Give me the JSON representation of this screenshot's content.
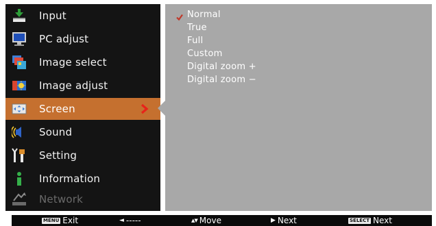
{
  "menu": {
    "items": [
      {
        "label": "Input",
        "icon": "input-icon"
      },
      {
        "label": "PC adjust",
        "icon": "monitor-icon"
      },
      {
        "label": "Image select",
        "icon": "image-select-icon"
      },
      {
        "label": "Image adjust",
        "icon": "image-adjust-icon"
      },
      {
        "label": "Screen",
        "icon": "screen-icon"
      },
      {
        "label": "Sound",
        "icon": "speaker-icon"
      },
      {
        "label": "Setting",
        "icon": "wrench-icon"
      },
      {
        "label": "Information",
        "icon": "info-icon"
      },
      {
        "label": "Network",
        "icon": "network-icon"
      }
    ],
    "selected": "Screen",
    "disabled": [
      "Network"
    ],
    "accent_color": "#c5702f"
  },
  "submenu": {
    "options": [
      "Normal",
      "True",
      "Full",
      "Custom",
      "Digital zoom +",
      "Digital zoom −"
    ],
    "checked": "Normal",
    "check_color": "#c0392b"
  },
  "help_bar": {
    "exit_key": "MENU",
    "exit_label": "Exit",
    "back_glyph": "◄",
    "back_label": "-----",
    "move_glyph": "▲▼",
    "move_label": "Move",
    "next_glyph": "▶",
    "next_label": "Next",
    "select_key": "SELECT",
    "select_label": "Next"
  }
}
